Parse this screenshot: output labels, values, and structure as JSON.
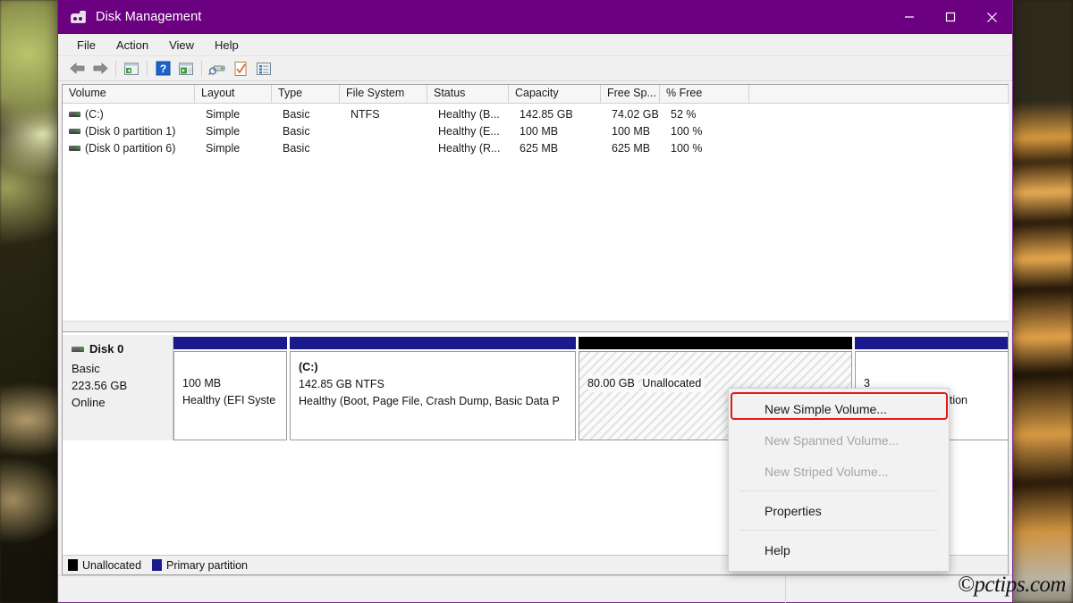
{
  "window": {
    "title": "Disk Management",
    "app_icon": "disk-drive-icon",
    "titlebar_color": "#6b0080",
    "controls": {
      "minimize": "Minimize",
      "maximize": "Maximize",
      "close": "Close"
    }
  },
  "menubar": {
    "items": [
      "File",
      "Action",
      "View",
      "Help"
    ]
  },
  "toolbar": {
    "icons": [
      "back-arrow-icon",
      "forward-arrow-icon",
      "up-one-level-icon",
      "help-icon",
      "show-action-pane-icon",
      "rescan-disks-icon",
      "properties-icon",
      "list-view-icon"
    ]
  },
  "volume_list": {
    "columns": [
      "Volume",
      "Layout",
      "Type",
      "File System",
      "Status",
      "Capacity",
      "Free Sp...",
      "% Free",
      ""
    ],
    "rows": [
      {
        "volume": "(C:)",
        "layout": "Simple",
        "type": "Basic",
        "file_system": "NTFS",
        "status": "Healthy (B...",
        "capacity": "142.85 GB",
        "free_space": "74.02 GB",
        "percent_free": "52 %"
      },
      {
        "volume": "(Disk 0 partition 1)",
        "layout": "Simple",
        "type": "Basic",
        "file_system": "",
        "status": "Healthy (E...",
        "capacity": "100 MB",
        "free_space": "100 MB",
        "percent_free": "100 %"
      },
      {
        "volume": "(Disk 0 partition 6)",
        "layout": "Simple",
        "type": "Basic",
        "file_system": "",
        "status": "Healthy (R...",
        "capacity": "625 MB",
        "free_space": "625 MB",
        "percent_free": "100 %"
      }
    ]
  },
  "disk_view": {
    "disk": {
      "name": "Disk 0",
      "type": "Basic",
      "size": "223.56 GB",
      "state": "Online"
    },
    "partitions": [
      {
        "label": "",
        "size_line": "100 MB",
        "status_line": "Healthy (EFI Syste",
        "kind": "primary"
      },
      {
        "label": "(C:)",
        "size_line": "142.85 GB NTFS",
        "status_line": "Healthy (Boot, Page File, Crash Dump, Basic Data P",
        "kind": "primary"
      },
      {
        "label": "",
        "size_line": "80.00 GB",
        "status_line": "Unallocated",
        "kind": "unallocated"
      },
      {
        "label": "",
        "size_line": "3",
        "status_line": "y (Recovery Partition",
        "kind": "primary"
      }
    ],
    "legend": [
      {
        "name": "Unallocated",
        "color": "#000000"
      },
      {
        "name": "Primary partition",
        "color": "#1a1a8c"
      }
    ]
  },
  "context_menu": {
    "items": [
      {
        "label": "New Simple Volume...",
        "disabled": false,
        "highlighted": true
      },
      {
        "label": "New Spanned Volume...",
        "disabled": true,
        "highlighted": false
      },
      {
        "label": "New Striped Volume...",
        "disabled": true,
        "highlighted": false
      },
      {
        "label": "Properties",
        "disabled": false,
        "highlighted": false
      },
      {
        "label": "Help",
        "disabled": false,
        "highlighted": false
      }
    ],
    "highlight_color": "#e01b1b"
  },
  "watermark": {
    "text": "©pctips.com"
  }
}
